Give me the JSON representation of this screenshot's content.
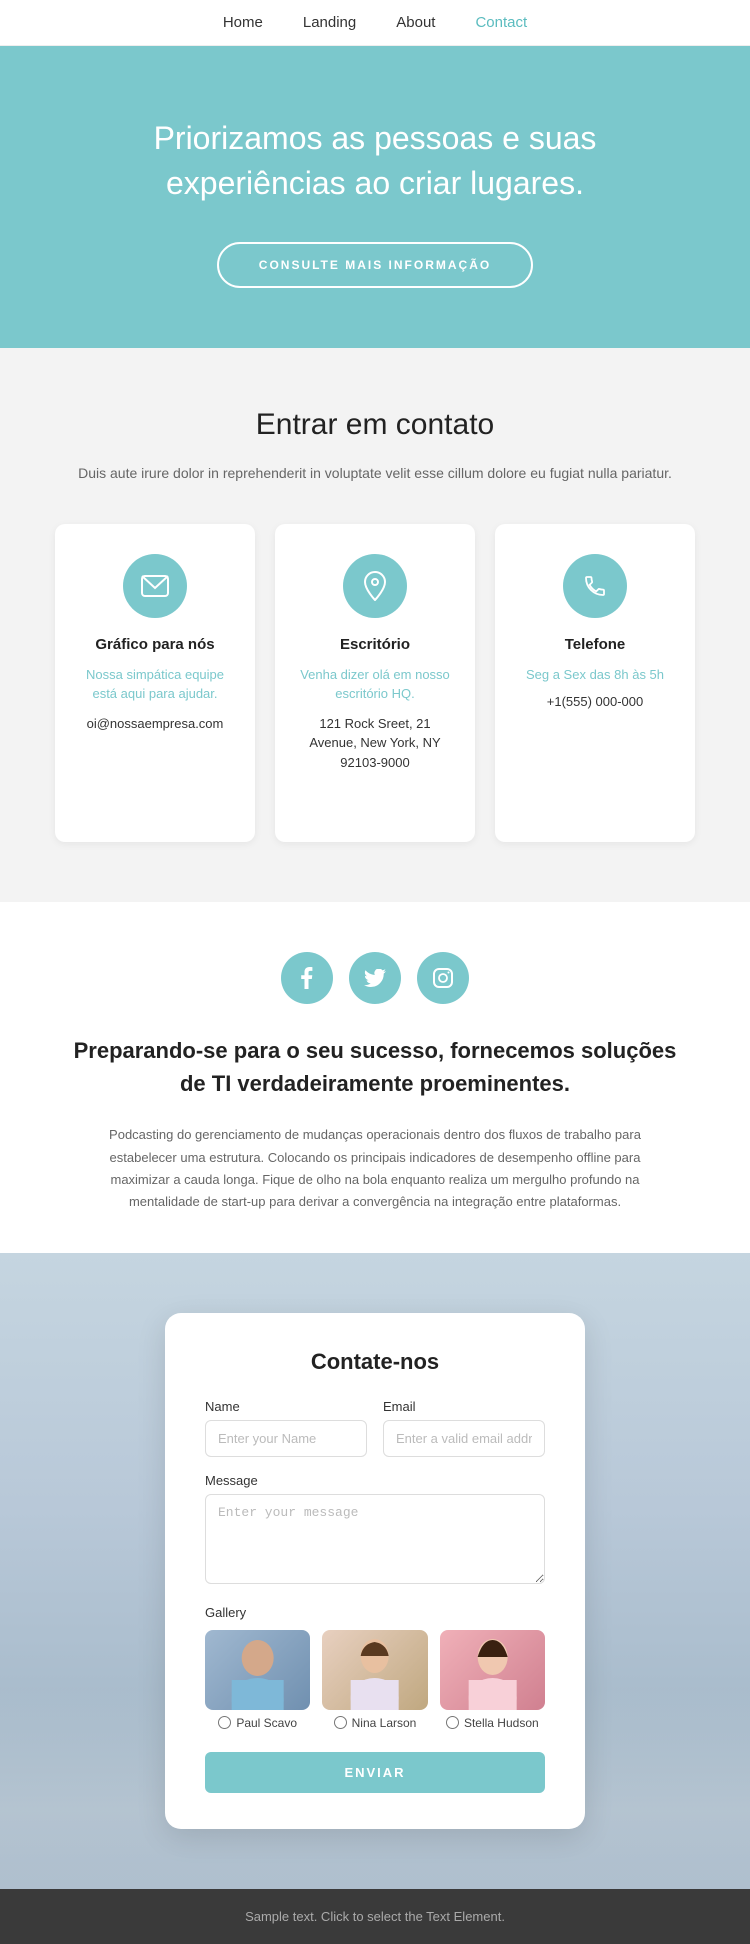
{
  "nav": {
    "items": [
      {
        "label": "Home",
        "active": false
      },
      {
        "label": "Landing",
        "active": false
      },
      {
        "label": "About",
        "active": false
      },
      {
        "label": "Contact",
        "active": true
      }
    ]
  },
  "hero": {
    "title": "Priorizamos as pessoas e suas experiências ao criar lugares.",
    "cta": "CONSULTE MAIS INFORMAÇÃO"
  },
  "contact_section": {
    "title": "Entrar em contato",
    "subtitle": "Duis aute irure dolor in reprehenderit in voluptate velit esse cillum dolore eu fugiat nulla pariatur.",
    "cards": [
      {
        "title": "Gráfico para nós",
        "link": "Nossa simpática equipe está aqui para ajudar.",
        "text": "oi@nossaempresa.com",
        "icon": "✉"
      },
      {
        "title": "Escritório",
        "link": "Venha dizer olá em nosso escritório HQ.",
        "text": "121 Rock Sreet, 21 Avenue, New York, NY 92103-9000",
        "icon": "📍"
      },
      {
        "title": "Telefone",
        "time": "Seg a Sex das 8h às 5h",
        "phone": "+1(555) 000-000",
        "icon": "📞"
      }
    ]
  },
  "social_section": {
    "heading": "Preparando-se para o seu sucesso, fornecemos soluções de TI verdadeiramente proeminentes.",
    "body": "Podcasting do gerenciamento de mudanças operacionais dentro dos fluxos de trabalho para estabelecer uma estrutura. Colocando os principais indicadores de desempenho offline para maximizar a cauda longa. Fique de olho na bola enquanto realiza um mergulho profundo na mentalidade de start-up para derivar a convergência na integração entre plataformas.",
    "icons": [
      "f",
      "t",
      "i"
    ]
  },
  "form_section": {
    "title": "Contate-nos",
    "name_label": "Name",
    "name_placeholder": "Enter your Name",
    "email_label": "Email",
    "email_placeholder": "Enter a valid email address",
    "message_label": "Message",
    "message_placeholder": "Enter your message",
    "gallery_label": "Gallery",
    "gallery_people": [
      {
        "name": "Paul Scavo"
      },
      {
        "name": "Nina Larson"
      },
      {
        "name": "Stella Hudson"
      }
    ],
    "submit_label": "ENVIAR"
  },
  "footer": {
    "text": "Sample text. Click to select the Text Element."
  }
}
